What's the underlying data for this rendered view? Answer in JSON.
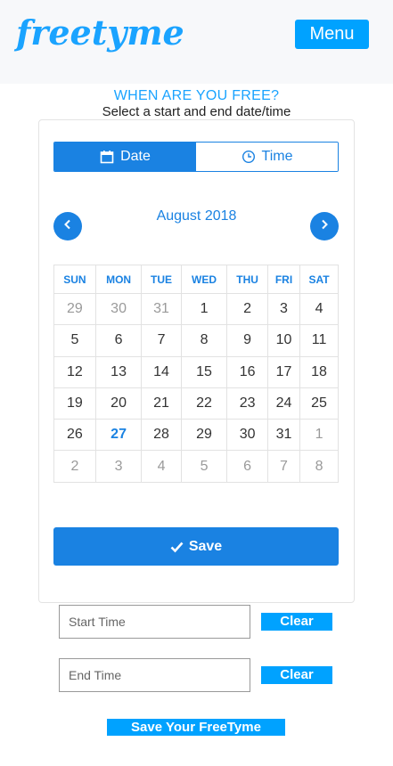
{
  "header": {
    "logo_text": "freetyme",
    "menu_label": "Menu"
  },
  "prompt": {
    "title": "WHEN ARE YOU FREE?",
    "subtitle": "Select a start and end date/time"
  },
  "toggle": {
    "date_label": "Date",
    "time_label": "Time",
    "active": "Date"
  },
  "calendar": {
    "month_label": "August 2018",
    "weekdays": [
      "SUN",
      "MON",
      "TUE",
      "WED",
      "THU",
      "FRI",
      "SAT"
    ],
    "weeks": [
      [
        {
          "d": "29",
          "m": true
        },
        {
          "d": "30",
          "m": true
        },
        {
          "d": "31",
          "m": true
        },
        {
          "d": "1"
        },
        {
          "d": "2"
        },
        {
          "d": "3"
        },
        {
          "d": "4"
        }
      ],
      [
        {
          "d": "5"
        },
        {
          "d": "6"
        },
        {
          "d": "7"
        },
        {
          "d": "8"
        },
        {
          "d": "9"
        },
        {
          "d": "10"
        },
        {
          "d": "11"
        }
      ],
      [
        {
          "d": "12"
        },
        {
          "d": "13"
        },
        {
          "d": "14"
        },
        {
          "d": "15"
        },
        {
          "d": "16"
        },
        {
          "d": "17"
        },
        {
          "d": "18"
        }
      ],
      [
        {
          "d": "19"
        },
        {
          "d": "20"
        },
        {
          "d": "21"
        },
        {
          "d": "22"
        },
        {
          "d": "23"
        },
        {
          "d": "24"
        },
        {
          "d": "25"
        }
      ],
      [
        {
          "d": "26"
        },
        {
          "d": "27",
          "today": true
        },
        {
          "d": "28"
        },
        {
          "d": "29"
        },
        {
          "d": "30"
        },
        {
          "d": "31"
        },
        {
          "d": "1",
          "m": true
        }
      ],
      [
        {
          "d": "2",
          "m": true
        },
        {
          "d": "3",
          "m": true
        },
        {
          "d": "4",
          "m": true
        },
        {
          "d": "5",
          "m": true
        },
        {
          "d": "6",
          "m": true
        },
        {
          "d": "7",
          "m": true
        },
        {
          "d": "8",
          "m": true
        }
      ]
    ]
  },
  "save_label": "Save",
  "form": {
    "start_placeholder": "Start Time",
    "end_placeholder": "End Time",
    "clear_label": "Clear",
    "submit_label": "Save Your FreeTyme"
  },
  "colors": {
    "accent": "#1a82e2",
    "brand": "#00a2ff",
    "muted_day": "#9a9a9a"
  },
  "icons": {
    "date": "calendar-icon",
    "time": "clock-icon",
    "prev": "chevron-left-icon",
    "next": "chevron-right-icon",
    "save": "checkmark-icon"
  }
}
